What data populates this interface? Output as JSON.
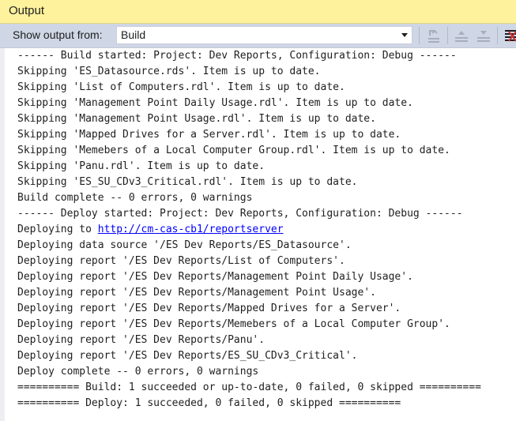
{
  "window": {
    "title": "Output"
  },
  "toolbar": {
    "show_from_label": "Show output from:",
    "source_value": "Build",
    "buttons": [
      {
        "name": "find-message-in-code-button",
        "icon": "go-to-message-icon",
        "enabled": false
      },
      {
        "name": "go-to-previous-message-button",
        "icon": "previous-message-icon",
        "enabled": false
      },
      {
        "name": "go-to-next-message-button",
        "icon": "next-message-icon",
        "enabled": false
      },
      {
        "name": "clear-all-button",
        "icon": "clear-all-icon",
        "enabled": true
      }
    ]
  },
  "output": {
    "lines": [
      "------ Build started: Project: Dev Reports, Configuration: Debug ------",
      "Skipping 'ES_Datasource.rds'. Item is up to date.",
      "Skipping 'List of Computers.rdl'. Item is up to date.",
      "Skipping 'Management Point Daily Usage.rdl'. Item is up to date.",
      "Skipping 'Management Point Usage.rdl'. Item is up to date.",
      "Skipping 'Mapped Drives for a Server.rdl'. Item is up to date.",
      "Skipping 'Memebers of a Local Computer Group.rdl'. Item is up to date.",
      "Skipping 'Panu.rdl'. Item is up to date.",
      "Skipping 'ES_SU_CDv3_Critical.rdl'. Item is up to date.",
      "Build complete -- 0 errors, 0 warnings",
      "------ Deploy started: Project: Dev Reports, Configuration: Debug ------"
    ],
    "deploy_prefix": "Deploying to ",
    "deploy_url": "http://cm-cas-cb1/reportserver",
    "lines_after": [
      "Deploying data source '/ES Dev Reports/ES_Datasource'.",
      "Deploying report '/ES Dev Reports/List of Computers'.",
      "Deploying report '/ES Dev Reports/Management Point Daily Usage'.",
      "Deploying report '/ES Dev Reports/Management Point Usage'.",
      "Deploying report '/ES Dev Reports/Mapped Drives for a Server'.",
      "Deploying report '/ES Dev Reports/Memebers of a Local Computer Group'.",
      "Deploying report '/ES Dev Reports/Panu'.",
      "Deploying report '/ES Dev Reports/ES_SU_CDv3_Critical'.",
      "Deploy complete -- 0 errors, 0 warnings",
      "========== Build: 1 succeeded or up-to-date, 0 failed, 0 skipped ==========",
      "========== Deploy: 1 succeeded, 0 failed, 0 skipped =========="
    ]
  },
  "colors": {
    "title_bar": "#fff29d",
    "toolbar": "#cfd6e5",
    "link": "#0000ff"
  }
}
